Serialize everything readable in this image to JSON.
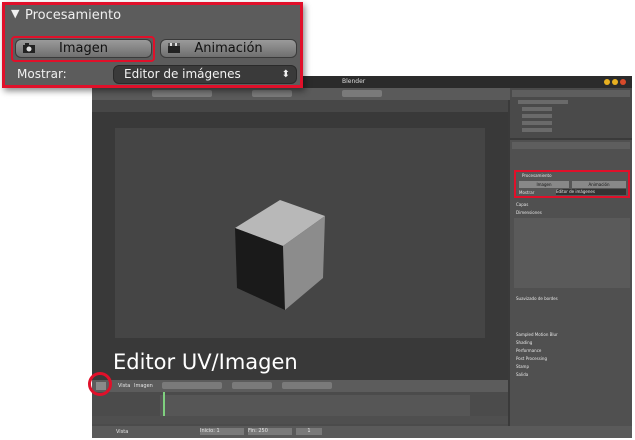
{
  "popup": {
    "section_title": "Procesamiento",
    "render_image_label": "Imagen",
    "render_animation_label": "Animación",
    "display_label": "Mostrar:",
    "display_value": "Editor de imágenes"
  },
  "window": {
    "title": "Blender"
  },
  "overlay_label": "Editor UV/Imagen",
  "properties": {
    "render_title": "Procesamiento",
    "image_btn": "Imagen",
    "anim_btn": "Animación",
    "display_label": "Mostrar",
    "display_value": "Editor de imágenes",
    "sections": [
      "Capas",
      "Dimensiones",
      "Suavizado de bordes",
      "Sampled Motion Blur",
      "Shading",
      "Performance",
      "Post Processing",
      "Stamp",
      "Salida"
    ]
  },
  "uv_header": {
    "view": "Vista",
    "image": "Imagen"
  },
  "bottom": {
    "view": "Vista",
    "start_label": "Inicio: 1",
    "end_label": "Fin: 250",
    "frame": "1"
  },
  "colors": {
    "accent_red": "#e0102a",
    "panel_bg": "#5c5c5c"
  }
}
